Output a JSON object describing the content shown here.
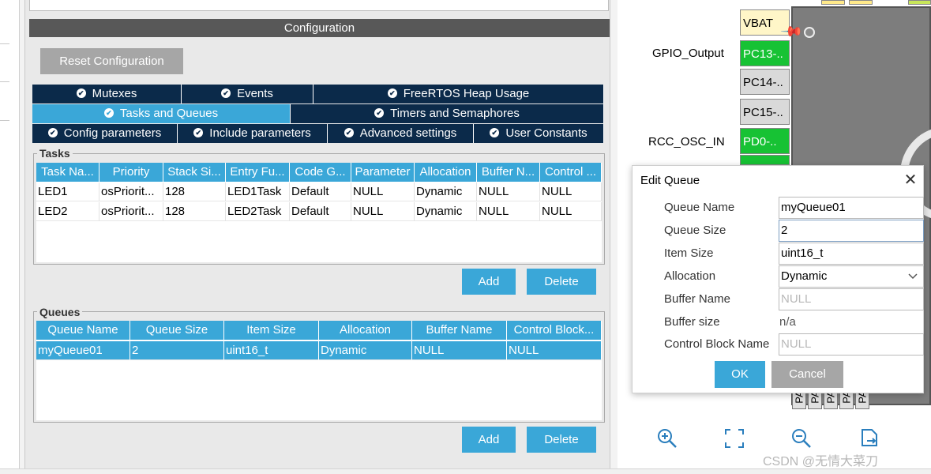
{
  "config": {
    "header": "Configuration",
    "reset_button": "Reset Configuration"
  },
  "tabs": {
    "row1": [
      "Mutexes",
      "Events",
      "FreeRTOS Heap Usage"
    ],
    "row2": [
      "Tasks and Queues",
      "Timers and Semaphores"
    ],
    "row3": [
      "Config parameters",
      "Include parameters",
      "Advanced settings",
      "User Constants"
    ],
    "active": "Tasks and Queues"
  },
  "tasks": {
    "legend": "Tasks",
    "columns": [
      "Task Na...",
      "Priority",
      "Stack Si...",
      "Entry Fu...",
      "Code G...",
      "Parameter",
      "Allocation",
      "Buffer N...",
      "Control ..."
    ],
    "rows": [
      [
        "LED1",
        "osPriorit...",
        "128",
        "LED1Task",
        "Default",
        "NULL",
        "Dynamic",
        "NULL",
        "NULL"
      ],
      [
        "LED2",
        "osPriorit...",
        "128",
        "LED2Task",
        "Default",
        "NULL",
        "Dynamic",
        "NULL",
        "NULL"
      ]
    ],
    "add_label": "Add",
    "delete_label": "Delete"
  },
  "queues": {
    "legend": "Queues",
    "columns": [
      "Queue Name",
      "Queue Size",
      "Item Size",
      "Allocation",
      "Buffer Name",
      "Control Block..."
    ],
    "rows": [
      [
        "myQueue01",
        "2",
        "uint16_t",
        "Dynamic",
        "NULL",
        "NULL"
      ]
    ],
    "add_label": "Add",
    "delete_label": "Delete"
  },
  "chip": {
    "pins": [
      "VBAT",
      "PC13-..",
      "PC14-..",
      "PC15-..",
      "PD0-.."
    ],
    "pin_labels": {
      "gpio": "GPIO_Output",
      "rcc": "RCC_OSC_IN"
    },
    "bottom_pins": [
      "PA",
      "PA",
      "PA",
      "PA",
      "PA"
    ],
    "colors": {
      "green": "#17c234",
      "yellow": "#fff6c8",
      "grey": "#d9d9d9",
      "body": "#7d7d7d"
    }
  },
  "dialog": {
    "title": "Edit Queue",
    "close": "✕",
    "fields": {
      "queue_name": {
        "label": "Queue Name",
        "value": "myQueue01"
      },
      "queue_size": {
        "label": "Queue Size",
        "value": "2"
      },
      "item_size": {
        "label": "Item Size",
        "value": "uint16_t"
      },
      "allocation": {
        "label": "Allocation",
        "value": "Dynamic"
      },
      "buffer_name": {
        "label": "Buffer Name",
        "placeholder": "NULL"
      },
      "buffer_size": {
        "label": "Buffer size",
        "value": "n/a"
      },
      "control_block": {
        "label": "Control Block Name",
        "placeholder": "NULL"
      }
    },
    "ok": "OK",
    "cancel": "Cancel"
  },
  "toolbar": {
    "icons": [
      "zoom-in-icon",
      "fit-screen-icon",
      "zoom-out-icon",
      "export-icon"
    ]
  },
  "watermark": "CSDN @无情大菜刀"
}
